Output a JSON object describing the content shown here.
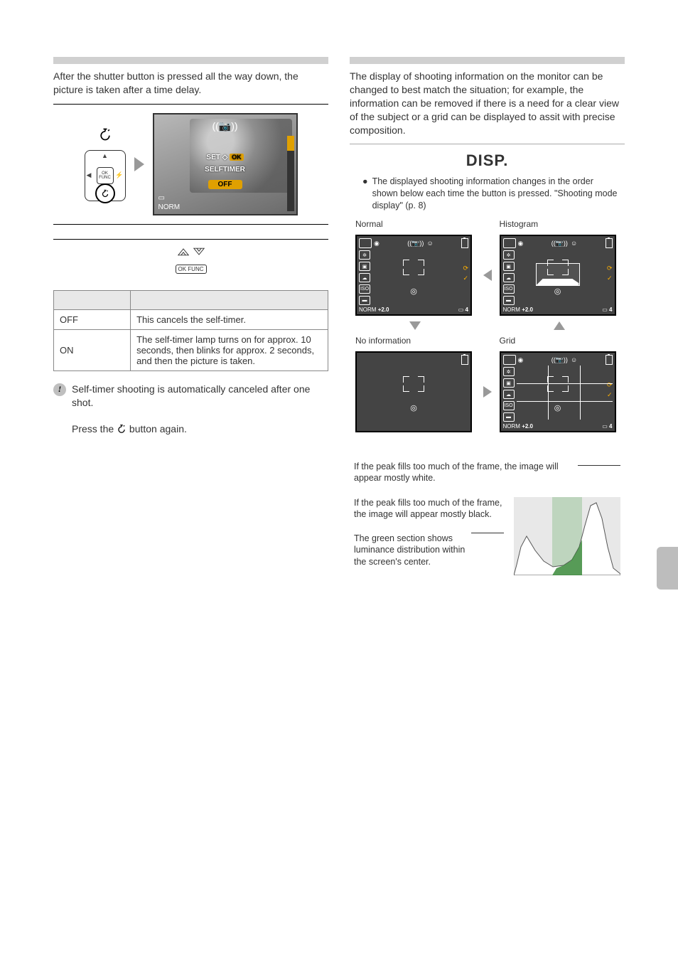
{
  "left": {
    "intro": "After the shutter button is pressed all the way down, the picture is taken after a time delay.",
    "lcd": {
      "set_label": "SET",
      "ok_label": "OK",
      "selftimer_label": "SELFTIMER",
      "off_pill": "OFF"
    },
    "dpad_center": "OK FUNC",
    "step2_okfunc": "OK FUNC",
    "table": {
      "off_label": "OFF",
      "off_desc": "This cancels the self-timer.",
      "on_label": "ON",
      "on_desc": "The self-timer lamp turns on for approx. 10 seconds, then blinks for approx. 2 seconds, and then the picture is taken."
    },
    "note": "Self-timer shooting is automatically canceled after one shot.",
    "cancel_line_a": "Press the ",
    "cancel_line_b": " button again."
  },
  "right": {
    "intro": "The display of shooting information on the monitor can be changed to best match the situation; for example, the information can be removed if there is a need for a clear view of the subject or a grid can be displayed to assit with precise composition.",
    "disp_title": "DISP.",
    "bullet": "The displayed shooting information changes in the order shown below each time the button is pressed. \"Shooting mode display\" (p. 8)",
    "labels": {
      "normal": "Normal",
      "histogram": "Histogram",
      "noinfo": "No information",
      "grid": "Grid"
    },
    "disp_common": {
      "exp": "+2.0",
      "count": "4",
      "norm_badge": "NORM"
    },
    "readhist": {
      "white": "If the peak fills too much of the frame, the image will appear mostly white.",
      "black": "If the peak fills too much of the frame, the image will appear mostly black.",
      "green": "The green section shows luminance distribution within the screen's center."
    }
  }
}
